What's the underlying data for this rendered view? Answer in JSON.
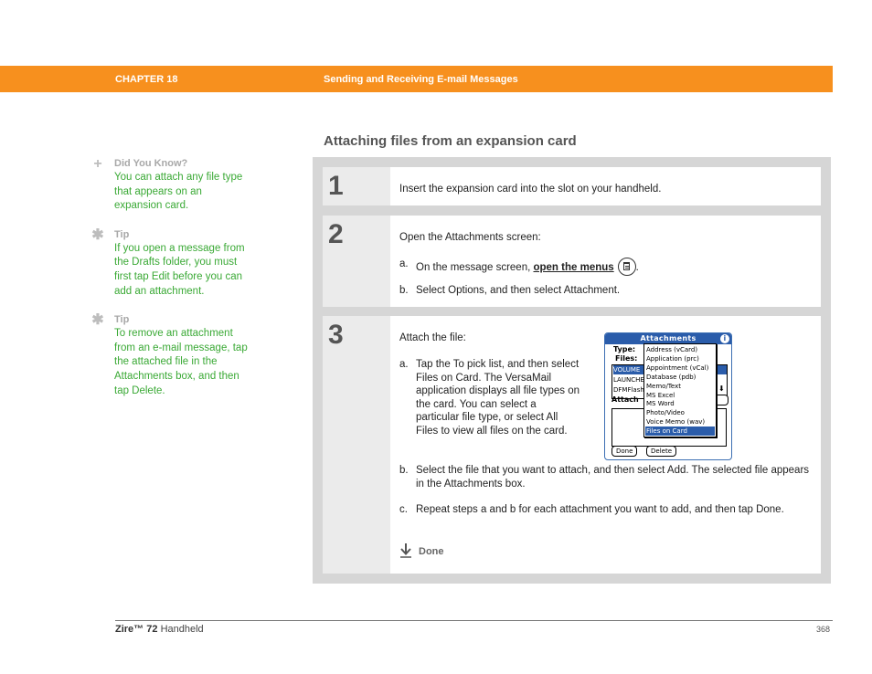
{
  "header": {
    "chapter": "CHAPTER 18",
    "title": "Sending and Receiving E-mail Messages",
    "bar_color": "#f7901e"
  },
  "sidebar": {
    "notes": [
      {
        "icon": "plus-icon",
        "label": "Did You Know?",
        "text": "You can attach any file type that appears on an expansion card."
      },
      {
        "icon": "asterisk-icon",
        "label": "Tip",
        "text": "If you open a message from the Drafts folder, you must first tap Edit before you can add an attachment."
      },
      {
        "icon": "asterisk-icon",
        "label": "Tip",
        "text": "To remove an attachment from an e-mail message, tap the attached file in the Attachments box, and then tap Delete."
      }
    ]
  },
  "section": {
    "title": "Attaching files from an expansion card"
  },
  "steps": [
    {
      "number": "1",
      "text": "Insert the expansion card into the slot on your handheld."
    },
    {
      "number": "2",
      "intro": "Open the Attachments screen:",
      "items": [
        {
          "letter": "a.",
          "text_before": "On the message screen, ",
          "link": "open the menus",
          "text_after": "."
        },
        {
          "letter": "b.",
          "text": "Select Options, and then select Attachment."
        }
      ]
    },
    {
      "number": "3",
      "intro": "Attach the file:",
      "items": [
        {
          "letter": "a.",
          "text": "Tap the To pick list, and then select Files on Card. The VersaMail application displays all file types on the card. You can select a particular file type, or select All Files to view all files on the card."
        },
        {
          "letter": "b.",
          "text": "Select the file that you want to attach, and then select Add. The selected file appears in the Attachments box."
        },
        {
          "letter": "c.",
          "text": "Repeat steps a and b for each attachment you want to add, and then tap Done."
        }
      ],
      "done_label": "Done"
    }
  ],
  "palm_screen": {
    "title": "Attachments",
    "type_label": "Type:",
    "files_label": "Files:",
    "attach_label": "Attach",
    "files": [
      "VOLUME",
      "LAUNCHE",
      "DFMFlash"
    ],
    "menu_items": [
      "Address (vCard)",
      "Application (prc)",
      "Appointment (vCal)",
      "Database (pdb)",
      "Memo/Text",
      "MS Excel",
      "MS Word",
      "Photo/Video",
      "Voice Memo (wav)",
      "Files on Card"
    ],
    "selected_menu_item": "Files on Card",
    "done_button": "Done",
    "delete_button": "Delete"
  },
  "footer": {
    "product_name": "Zire™",
    "product_model": "72",
    "product_suffix": "Handheld",
    "page_number": "368"
  }
}
